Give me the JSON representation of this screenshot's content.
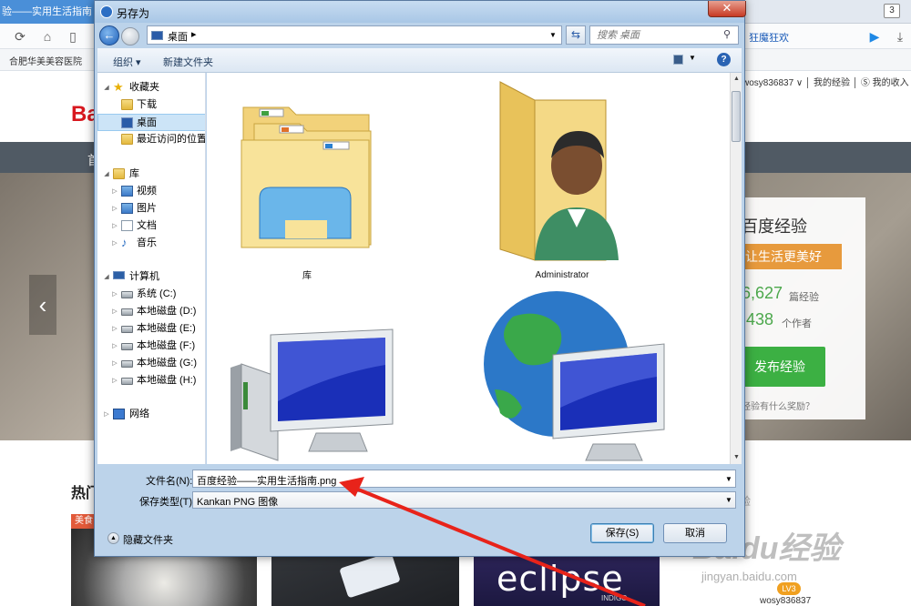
{
  "browser": {
    "tab_title": "验——实用生活指南",
    "tab_count": "3",
    "hot_link": "狂魔狂欢",
    "bookmark": "合肥华美美容医院",
    "user_bar": "wosy836837 ∨ │ 我的经验 │ Ⓢ 我的收入",
    "logo": "Ba",
    "menu_partial": "首",
    "hero_card": {
      "title": "百度经验",
      "slogan": "让生活更美好",
      "stat1": "6,627",
      "stat1_unit": "篇经验",
      "stat2": ",438",
      "stat2_unit": "个作者",
      "publish": "发布经验",
      "reward": "经验有什么奖励？"
    },
    "hot_section": "热门",
    "thumb_badge": "美食",
    "thumb3_text": "eclipse",
    "thumb3_sub": "INDIGO",
    "side_text": "验",
    "watermark": "Baidu经验",
    "watermark_url": "jingyan.baidu.com",
    "user_level": "LV3",
    "username": "wosy836837"
  },
  "dialog": {
    "title": "另存为",
    "close": "✕",
    "path": "桌面",
    "search_placeholder": "搜索 桌面",
    "toolbar": {
      "organize": "组织 ▾",
      "new_folder": "新建文件夹",
      "help": "?"
    },
    "nav": {
      "favorites": "收藏夹",
      "downloads": "下载",
      "desktop": "桌面",
      "recent": "最近访问的位置",
      "libraries": "库",
      "videos": "视频",
      "pictures": "图片",
      "documents": "文档",
      "music": "音乐",
      "computer": "计算机",
      "drive_c": "系统 (C:)",
      "drive_d": "本地磁盘 (D:)",
      "drive_e": "本地磁盘 (E:)",
      "drive_f": "本地磁盘 (F:)",
      "drive_g": "本地磁盘 (G:)",
      "drive_h": "本地磁盘 (H:)",
      "network": "网络"
    },
    "items": {
      "libraries": "库",
      "admin": "Administrator"
    },
    "filename_label": "文件名(N):",
    "filename_value": "百度经验——实用生活指南.png",
    "filetype_label": "保存类型(T):",
    "filetype_value": "Kankan PNG 图像",
    "hide_folders": "隐藏文件夹",
    "save": "保存(S)",
    "cancel": "取消"
  },
  "colors": {
    "dialog_frame": "#bcd3ea",
    "selection": "#cce4f7",
    "annotation_arrow": "#e8231a",
    "publish_button": "#3cb043"
  }
}
